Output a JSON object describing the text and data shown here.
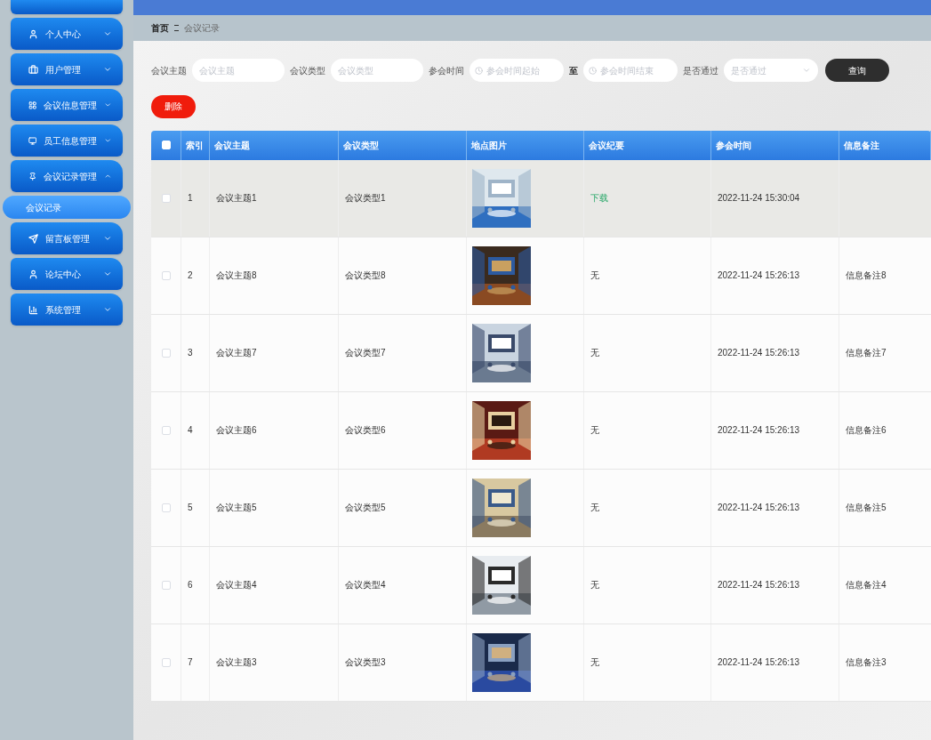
{
  "sidebar": {
    "items": [
      {
        "label": "个人中心",
        "expanded": false
      },
      {
        "label": "用户管理",
        "expanded": false
      },
      {
        "label": "会议信息管理",
        "expanded": false
      },
      {
        "label": "员工信息管理",
        "expanded": false
      },
      {
        "label": "会议记录管理",
        "expanded": true,
        "children": [
          {
            "label": "会议记录",
            "selected": true
          }
        ]
      },
      {
        "label": "留言板管理",
        "expanded": false
      },
      {
        "label": "论坛中心",
        "expanded": false
      },
      {
        "label": "系统管理",
        "expanded": false
      }
    ]
  },
  "breadcrumb": [
    "首页",
    "会议记录"
  ],
  "search": {
    "fields": [
      {
        "kind": "text",
        "label": "会议主题",
        "placeholder": "会议主题"
      },
      {
        "kind": "text",
        "label": "会议类型",
        "placeholder": "会议类型"
      },
      {
        "kind": "daterange",
        "label": "参会时间",
        "placeholder": "参会时间起始",
        "separator": "至",
        "placeholder_end": "参会时间结束"
      },
      {
        "kind": "select",
        "label": "是否通过",
        "placeholder": "是否通过"
      }
    ],
    "query_button": "查询",
    "delete_button": "删除"
  },
  "table": {
    "select_all": {
      "checked": false
    },
    "columns": [
      "索引",
      "会议主题",
      "会议类型",
      "地点图片",
      "会议纪要",
      "参会时间",
      "信息备注"
    ],
    "rows": [
      {
        "index": "1",
        "topic": "会议主题1",
        "type": "会议类型1",
        "minutes": {
          "text": "下载",
          "kind": "link"
        },
        "time": "2022-11-24 15:30:04",
        "checked": false,
        "hovered": true
      },
      {
        "index": "2",
        "topic": "会议主题8",
        "type": "会议类型8",
        "minutes": {
          "text": "无",
          "kind": "text"
        },
        "time": "2022-11-24 15:26:13",
        "note": "信息备注8",
        "checked": false,
        "hovered": false
      },
      {
        "index": "3",
        "topic": "会议主题7",
        "type": "会议类型7",
        "minutes": {
          "text": "无",
          "kind": "text"
        },
        "time": "2022-11-24 15:26:13",
        "note": "信息备注7",
        "checked": false,
        "hovered": false
      },
      {
        "index": "4",
        "topic": "会议主题6",
        "type": "会议类型6",
        "minutes": {
          "text": "无",
          "kind": "text"
        },
        "time": "2022-11-24 15:26:13",
        "note": "信息备注6",
        "checked": false,
        "hovered": false
      },
      {
        "index": "5",
        "topic": "会议主题5",
        "type": "会议类型5",
        "minutes": {
          "text": "无",
          "kind": "text"
        },
        "time": "2022-11-24 15:26:13",
        "note": "信息备注5",
        "checked": false,
        "hovered": false
      },
      {
        "index": "6",
        "topic": "会议主题4",
        "type": "会议类型4",
        "minutes": {
          "text": "无",
          "kind": "text"
        },
        "time": "2022-11-24 15:26:13",
        "note": "信息备注4",
        "checked": false,
        "hovered": false
      },
      {
        "index": "7",
        "topic": "会议主题3",
        "type": "会议类型3",
        "minutes": {
          "text": "无",
          "kind": "text"
        },
        "time": "2022-11-24 15:26:13",
        "note": "信息备注3",
        "checked": false,
        "hovered": false
      }
    ]
  }
}
